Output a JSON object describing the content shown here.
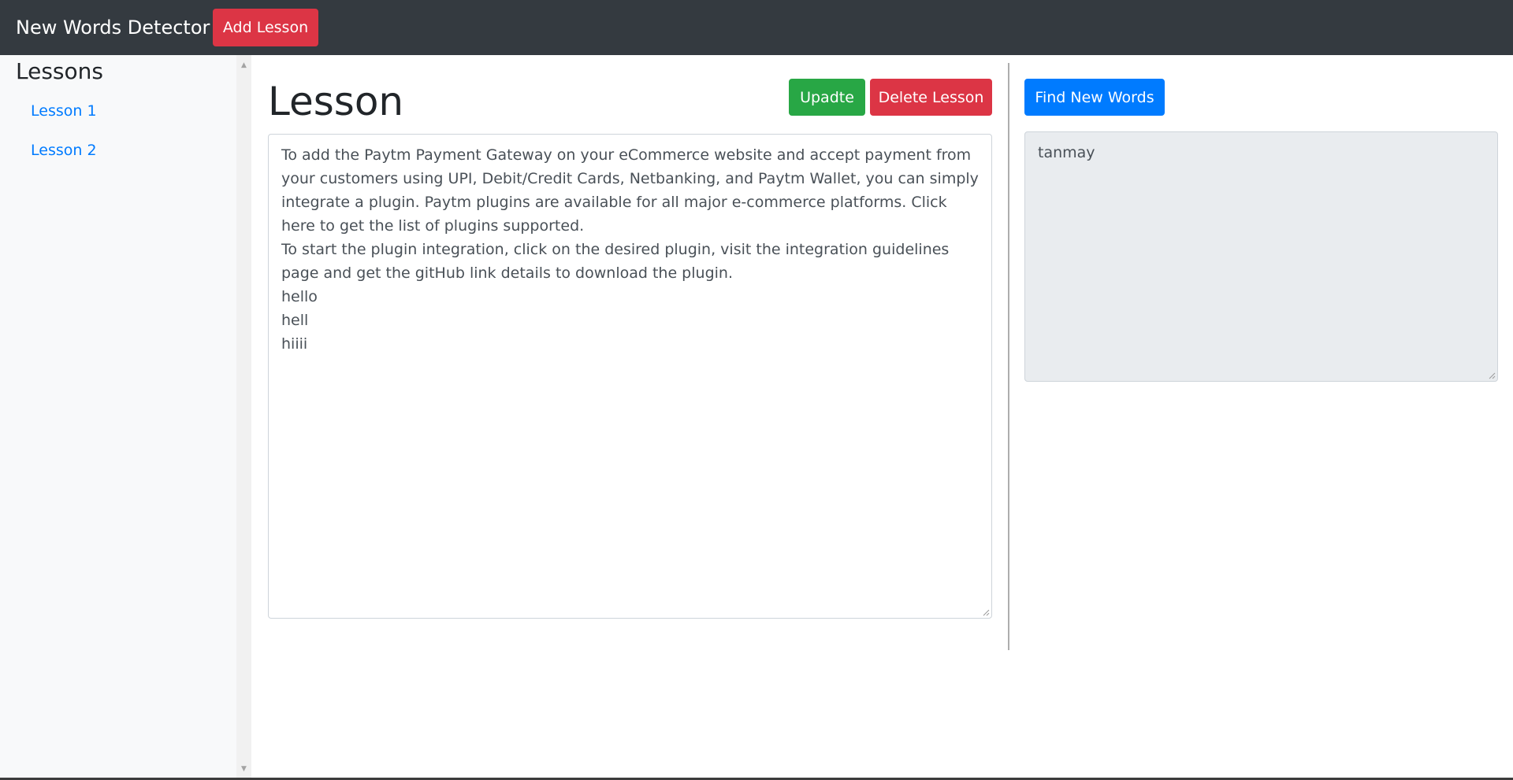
{
  "navbar": {
    "brand": "New Words Detector",
    "add_lesson_label": "Add Lesson"
  },
  "sidebar": {
    "title": "Lessons",
    "items": [
      {
        "label": "Lesson 1"
      },
      {
        "label": "Lesson 2"
      }
    ]
  },
  "main": {
    "title": "Lesson",
    "update_label": "Upadte",
    "delete_label": "Delete Lesson",
    "lesson_lines": [
      "To add the Paytm Payment Gateway on your eCommerce website and accept payment from your customers using UPI, Debit/Credit Cards, Netbanking, and Paytm Wallet, you can simply integrate a plugin. Paytm plugins are available for all major e-commerce platforms. Click here to get the list of plugins supported.",
      "To start the plugin integration, click on the desired plugin, visit the integration guidelines page and get the gitHub link details to download the plugin.",
      "hello",
      "hell",
      "hiiii"
    ]
  },
  "right_panel": {
    "find_label": "Find New Words",
    "new_words": "tanmay"
  },
  "icons": {
    "scroll_up": "scroll-up-arrow-icon",
    "scroll_down": "scroll-down-arrow-icon",
    "resize": "resize-grip-icon"
  },
  "colors": {
    "navbar": "#343a40",
    "danger": "#dc3545",
    "success": "#28a745",
    "primary": "#007bff",
    "sidebar_bg": "#f8f9fa",
    "readonly_bg": "#e9ecef"
  }
}
